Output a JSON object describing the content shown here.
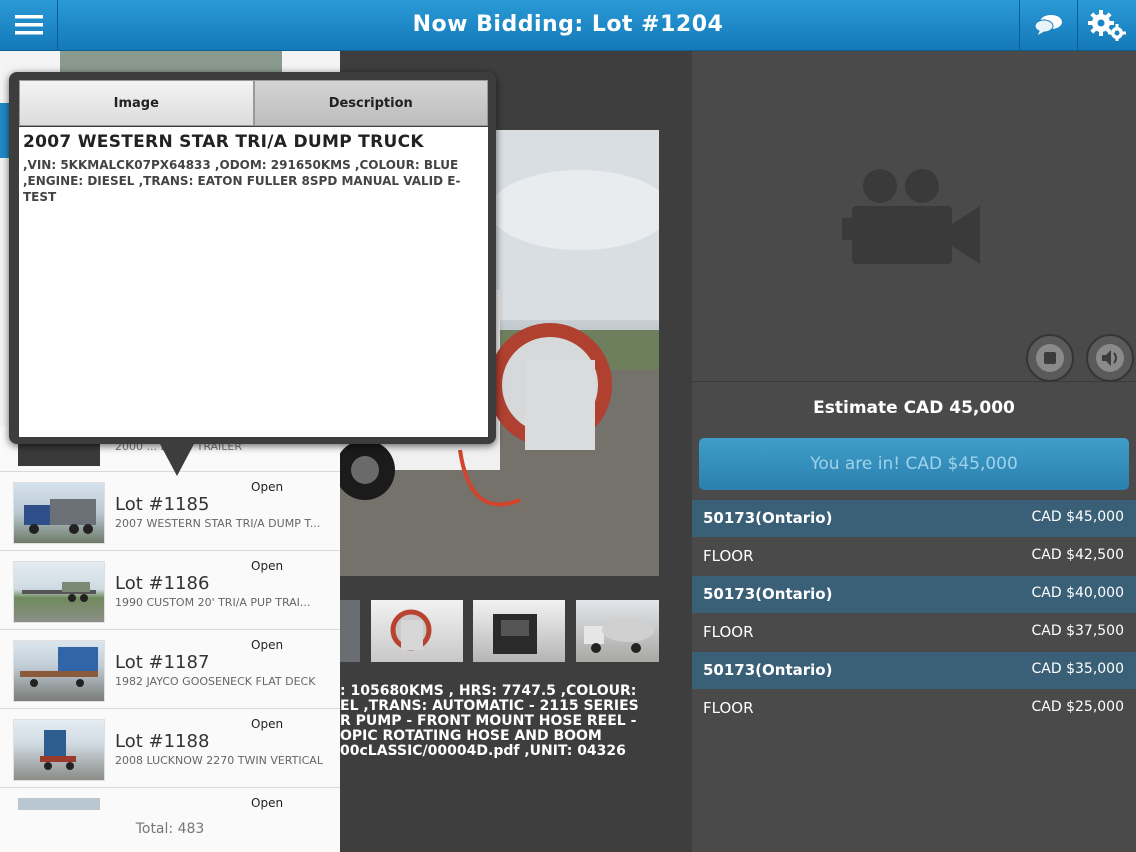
{
  "header": {
    "title": "Now Bidding: Lot #1204"
  },
  "popover": {
    "tabs": [
      {
        "label": "Image"
      },
      {
        "label": "Description"
      }
    ],
    "title": "2007 WESTERN STAR TRI/A DUMP TRUCK",
    "text": ",VIN: 5KKMALCK07PX64833 ,ODOM: 291650KMS ,COLOUR: BLUE ,ENGINE: DIESEL ,TRANS: EATON FULLER 8SPD MANUAL VALID E-TEST"
  },
  "lots": [
    {
      "status": "Open",
      "lot": "Lot #1185",
      "desc": "2007 WESTERN STAR TRI/A DUMP T..."
    },
    {
      "status": "Open",
      "lot": "Lot #1186",
      "desc": "1990 CUSTOM 20' TRI/A PUP TRAI..."
    },
    {
      "status": "Open",
      "lot": "Lot #1187",
      "desc": "1982 JAYCO GOOSENECK FLAT DECK"
    },
    {
      "status": "Open",
      "lot": "Lot #1188",
      "desc": "2008 LUCKNOW 2270 TWIN VERTICAL"
    },
    {
      "status": "Open"
    }
  ],
  "list_total": "Total: 483",
  "partial_desc_line": "2000 ... DUMP TRAILER",
  "main_description": ": 105680KMS , HRS: 7747.5 ,COLOUR:\nEL ,TRANS: AUTOMATIC - 2115 SERIES\nR PUMP - FRONT MOUNT HOSE REEL -\nOPIC ROTATING HOSE AND BOOM\n00cLASSIC/00004D.pdf ,UNIT: 04326",
  "estimate": "Estimate CAD 45,000",
  "bid_button": "You are in! CAD $45,000",
  "bids": [
    {
      "bidder": "50173(Ontario)",
      "amount": "CAD $45,000",
      "highlight": true
    },
    {
      "bidder": "FLOOR",
      "amount": "CAD $42,500",
      "highlight": false
    },
    {
      "bidder": "50173(Ontario)",
      "amount": "CAD $40,000",
      "highlight": true
    },
    {
      "bidder": "FLOOR",
      "amount": "CAD $37,500",
      "highlight": false
    },
    {
      "bidder": "50173(Ontario)",
      "amount": "CAD $35,000",
      "highlight": true
    },
    {
      "bidder": "FLOOR",
      "amount": "CAD $25,000",
      "highlight": false
    }
  ],
  "icons": {
    "menu": "menu-icon",
    "chat": "chat-icon",
    "gear": "gear-icon",
    "camera": "video-camera-icon",
    "stop": "stop-icon",
    "volume": "volume-icon"
  },
  "colors": {
    "header": "#1f8ac8",
    "bid_highlight": "#3a6077",
    "button": "#3590bf"
  }
}
